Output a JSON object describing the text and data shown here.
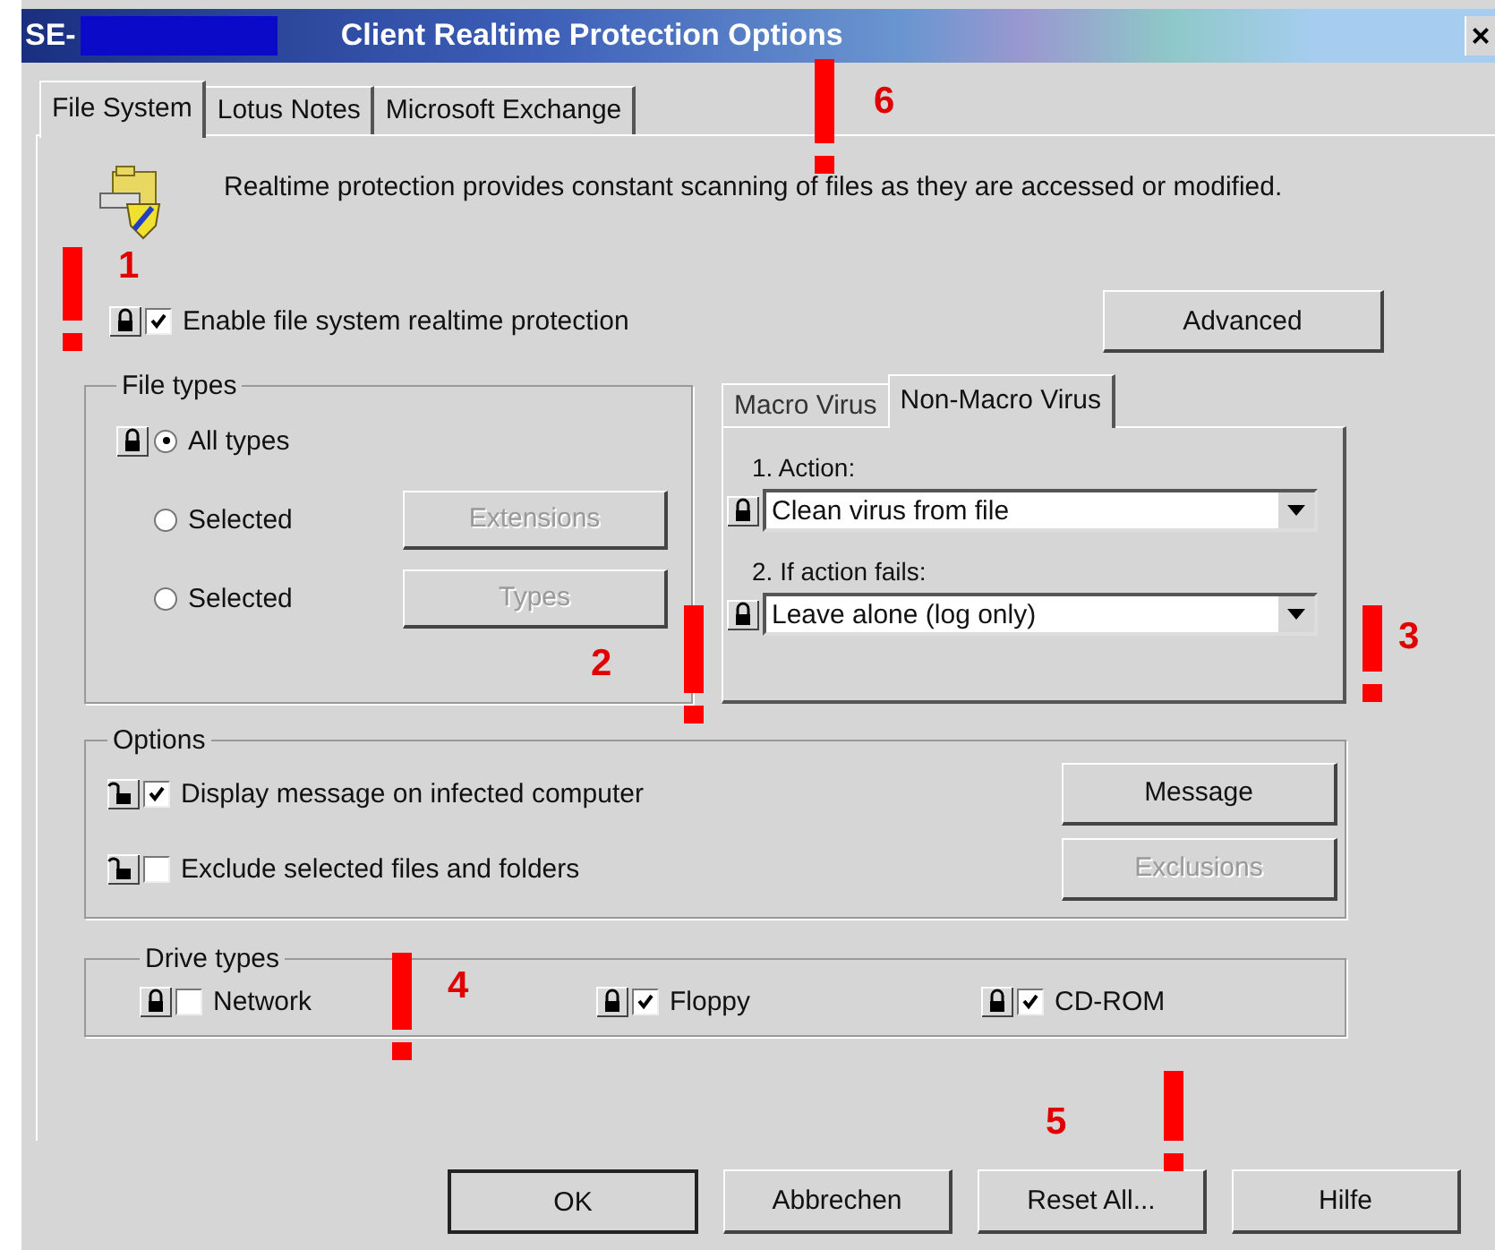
{
  "window": {
    "title_prefix": "SE-",
    "title": "Client Realtime Protection Options",
    "close": "×"
  },
  "tabs": [
    {
      "label": "File System",
      "selected": true
    },
    {
      "label": "Lotus Notes",
      "selected": false
    },
    {
      "label": "Microsoft Exchange",
      "selected": false
    }
  ],
  "description": "Realtime protection provides constant scanning of files as they are accessed or modified.",
  "enable": {
    "label": "Enable file system realtime protection",
    "checked": true,
    "locked": true
  },
  "advanced_button": "Advanced",
  "file_types": {
    "title": "File types",
    "options": [
      {
        "label": "All types",
        "selected": true,
        "locked": true
      },
      {
        "label": "Selected",
        "selected": false,
        "button": {
          "label": "Extensions",
          "disabled": true
        }
      },
      {
        "label": "Selected",
        "selected": false,
        "button": {
          "label": "Types",
          "disabled": true
        }
      }
    ]
  },
  "virus_tabs": [
    {
      "label": "Macro Virus",
      "selected": false
    },
    {
      "label": "Non-Macro Virus",
      "selected": true
    }
  ],
  "actions": [
    {
      "label": "1. Action:",
      "value": "Clean virus from file",
      "locked": true
    },
    {
      "label": "2. If action fails:",
      "value": "Leave alone (log only)",
      "locked": true
    }
  ],
  "options": {
    "title": "Options",
    "items": [
      {
        "label": "Display message on infected computer",
        "checked": true,
        "locked": false,
        "button": {
          "label": "Message",
          "disabled": false
        }
      },
      {
        "label": "Exclude selected files and folders",
        "checked": false,
        "locked": false,
        "button": {
          "label": "Exclusions",
          "disabled": true
        }
      }
    ]
  },
  "drive_types": {
    "title": "Drive types",
    "items": [
      {
        "label": "Network",
        "checked": false,
        "locked": true
      },
      {
        "label": "Floppy",
        "checked": true,
        "locked": true
      },
      {
        "label": "CD-ROM",
        "checked": true,
        "locked": true
      }
    ]
  },
  "footer_buttons": [
    {
      "label": "OK",
      "default": true
    },
    {
      "label": "Abbrechen",
      "default": false
    },
    {
      "label": "Reset All...",
      "default": false
    },
    {
      "label": "Hilfe",
      "default": false
    }
  ],
  "annotations": [
    {
      "label": "1"
    },
    {
      "label": "2"
    },
    {
      "label": "3"
    },
    {
      "label": "4"
    },
    {
      "label": "5"
    },
    {
      "label": "6"
    }
  ]
}
